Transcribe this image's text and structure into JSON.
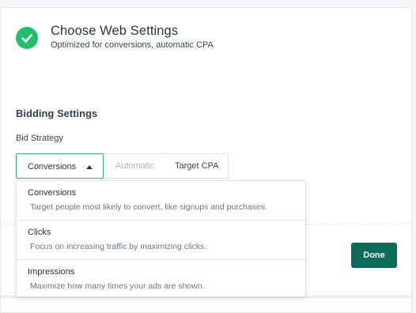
{
  "header": {
    "title": "Choose Web Settings",
    "subtitle": "Optimized for conversions, automatic CPA",
    "status_icon": "check-circle-icon",
    "status_color": "#1fbf6c"
  },
  "bidding": {
    "section_title": "Bidding Settings",
    "strategy_label": "Bid Strategy",
    "selected": "Conversions",
    "segments": [
      "Automatic",
      "Target CPA"
    ]
  },
  "dropdown": {
    "options": [
      {
        "title": "Conversions",
        "description": "Target people most likely to convert, like signups and purchases."
      },
      {
        "title": "Clicks",
        "description": "Focus on increasing traffic by maximizing clicks."
      },
      {
        "title": "Impressions",
        "description": "Maximize how many times your ads are shown."
      }
    ]
  },
  "actions": {
    "done_label": "Done",
    "done_color": "#0e6b5a"
  }
}
